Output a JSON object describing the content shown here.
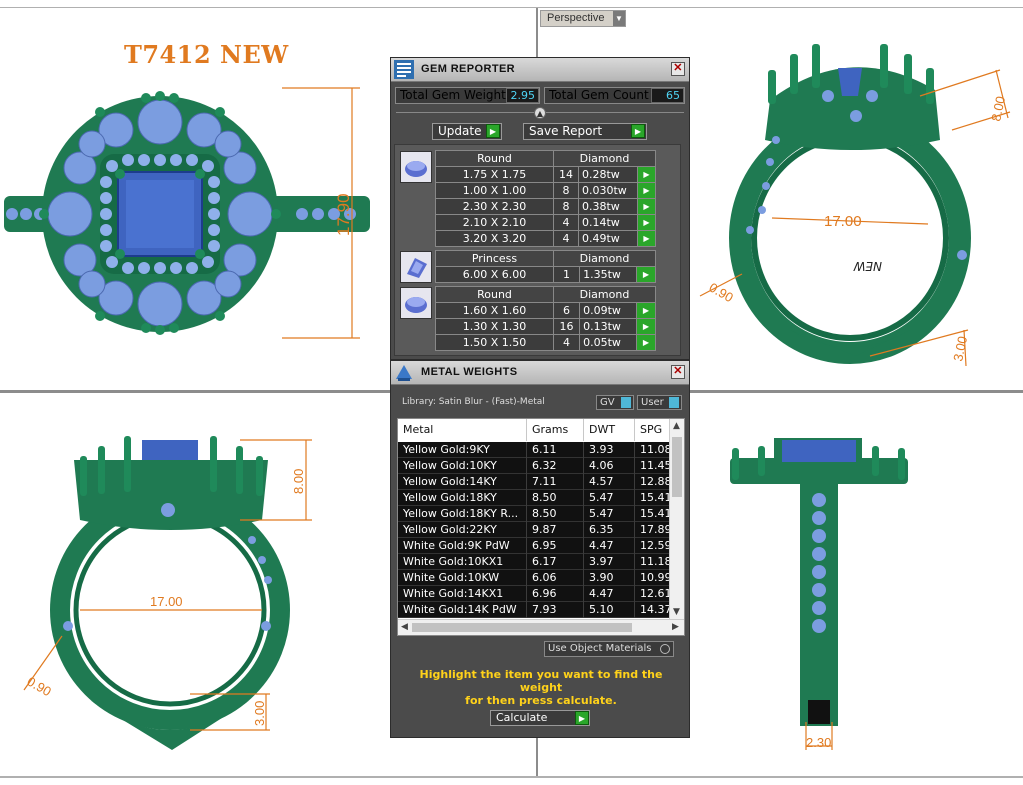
{
  "viewport": {
    "mode_label": "Perspective"
  },
  "model": {
    "title": "T7412 NEW",
    "dimensions": {
      "top_height": "17.90",
      "side_width": "17.00",
      "side_height": "8.00",
      "band_thickness": "0.90",
      "shank_height": "3.00",
      "band_width": "2.30"
    },
    "engraving": "NEW"
  },
  "gem_reporter": {
    "title": "GEM REPORTER",
    "total_weight_label": "Total Gem Weight",
    "total_weight_value": "2.95",
    "total_count_label": "Total Gem Count",
    "total_count_value": "65",
    "update_label": "Update",
    "save_report_label": "Save Report",
    "groups": [
      {
        "shape": "Round",
        "material": "Diamond",
        "icon": "round-gem-icon",
        "rows": [
          {
            "size": "1.75 X 1.75",
            "count": "14",
            "weight": "0.28tw"
          },
          {
            "size": "1.00 X 1.00",
            "count": "8",
            "weight": "0.030tw"
          },
          {
            "size": "2.30 X 2.30",
            "count": "8",
            "weight": "0.38tw"
          },
          {
            "size": "2.10 X 2.10",
            "count": "4",
            "weight": "0.14tw"
          },
          {
            "size": "3.20 X 3.20",
            "count": "4",
            "weight": "0.49tw"
          }
        ]
      },
      {
        "shape": "Princess",
        "material": "Diamond",
        "icon": "princess-gem-icon",
        "rows": [
          {
            "size": "6.00 X 6.00",
            "count": "1",
            "weight": "1.35tw"
          }
        ]
      },
      {
        "shape": "Round",
        "material": "Diamond",
        "icon": "round-gem-icon",
        "rows": [
          {
            "size": "1.60 X 1.60",
            "count": "6",
            "weight": "0.09tw"
          },
          {
            "size": "1.30 X 1.30",
            "count": "16",
            "weight": "0.13tw"
          },
          {
            "size": "1.50 X 1.50",
            "count": "4",
            "weight": "0.05tw"
          }
        ]
      }
    ]
  },
  "metal_weights": {
    "title": "METAL WEIGHTS",
    "library_label": "Library: Satin Blur - (Fast)-Metal",
    "gv_label": "GV",
    "user_label": "User",
    "columns": [
      "Metal",
      "Grams",
      "DWT",
      "SPG"
    ],
    "rows": [
      {
        "metal": "Yellow Gold:9KY",
        "grams": "6.11",
        "dwt": "3.93",
        "spg": "11.08"
      },
      {
        "metal": "Yellow Gold:10KY",
        "grams": "6.32",
        "dwt": "4.06",
        "spg": "11.45"
      },
      {
        "metal": "Yellow Gold:14KY",
        "grams": "7.11",
        "dwt": "4.57",
        "spg": "12.88"
      },
      {
        "metal": "Yellow Gold:18KY",
        "grams": "8.50",
        "dwt": "5.47",
        "spg": "15.41"
      },
      {
        "metal": "Yellow Gold:18KY R...",
        "grams": "8.50",
        "dwt": "5.47",
        "spg": "15.41"
      },
      {
        "metal": "Yellow Gold:22KY",
        "grams": "9.87",
        "dwt": "6.35",
        "spg": "17.89"
      },
      {
        "metal": "White Gold:9K PdW",
        "grams": "6.95",
        "dwt": "4.47",
        "spg": "12.59"
      },
      {
        "metal": "White Gold:10KX1",
        "grams": "6.17",
        "dwt": "3.97",
        "spg": "11.18"
      },
      {
        "metal": "White Gold:10KW",
        "grams": "6.06",
        "dwt": "3.90",
        "spg": "10.99"
      },
      {
        "metal": "White Gold:14KX1",
        "grams": "6.96",
        "dwt": "4.47",
        "spg": "12.61"
      },
      {
        "metal": "White Gold:14K PdW",
        "grams": "7.93",
        "dwt": "5.10",
        "spg": "14.37"
      }
    ],
    "use_object_materials_label": "Use Object Materials",
    "hint_line1": "Highlight the item you want to find the weight",
    "hint_line2": "for then press calculate.",
    "calculate_label": "Calculate"
  },
  "colors": {
    "metal_green": "#1f7a52",
    "gem_blue": "#7b9de0",
    "center_stone": "#3f64c0",
    "dimension_orange": "#e07a20",
    "panel_gray": "#4b4b4b"
  }
}
